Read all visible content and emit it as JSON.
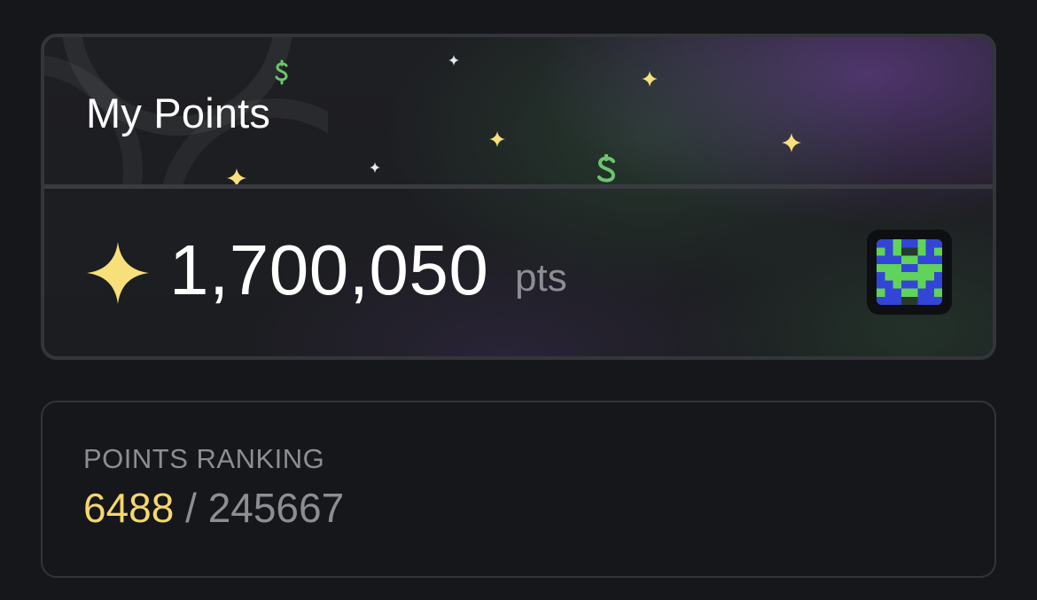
{
  "points_card": {
    "title": "My Points",
    "balance": "1,700,050",
    "unit": "pts",
    "sparkle_icon": "sparkle-icon",
    "avatar_icon": "pixel-avatar-icon",
    "colors": {
      "sparkle": "#f7e07a",
      "dollar": "#6cc46f",
      "avatar_green": "#5fd35a",
      "avatar_blue": "#3345d6"
    }
  },
  "ranking_card": {
    "label": "POINTS RANKING",
    "current_rank": "6488",
    "separator": "/",
    "total": "245667",
    "colors": {
      "current_rank": "#f5d76e",
      "total": "#8d8e94"
    }
  }
}
